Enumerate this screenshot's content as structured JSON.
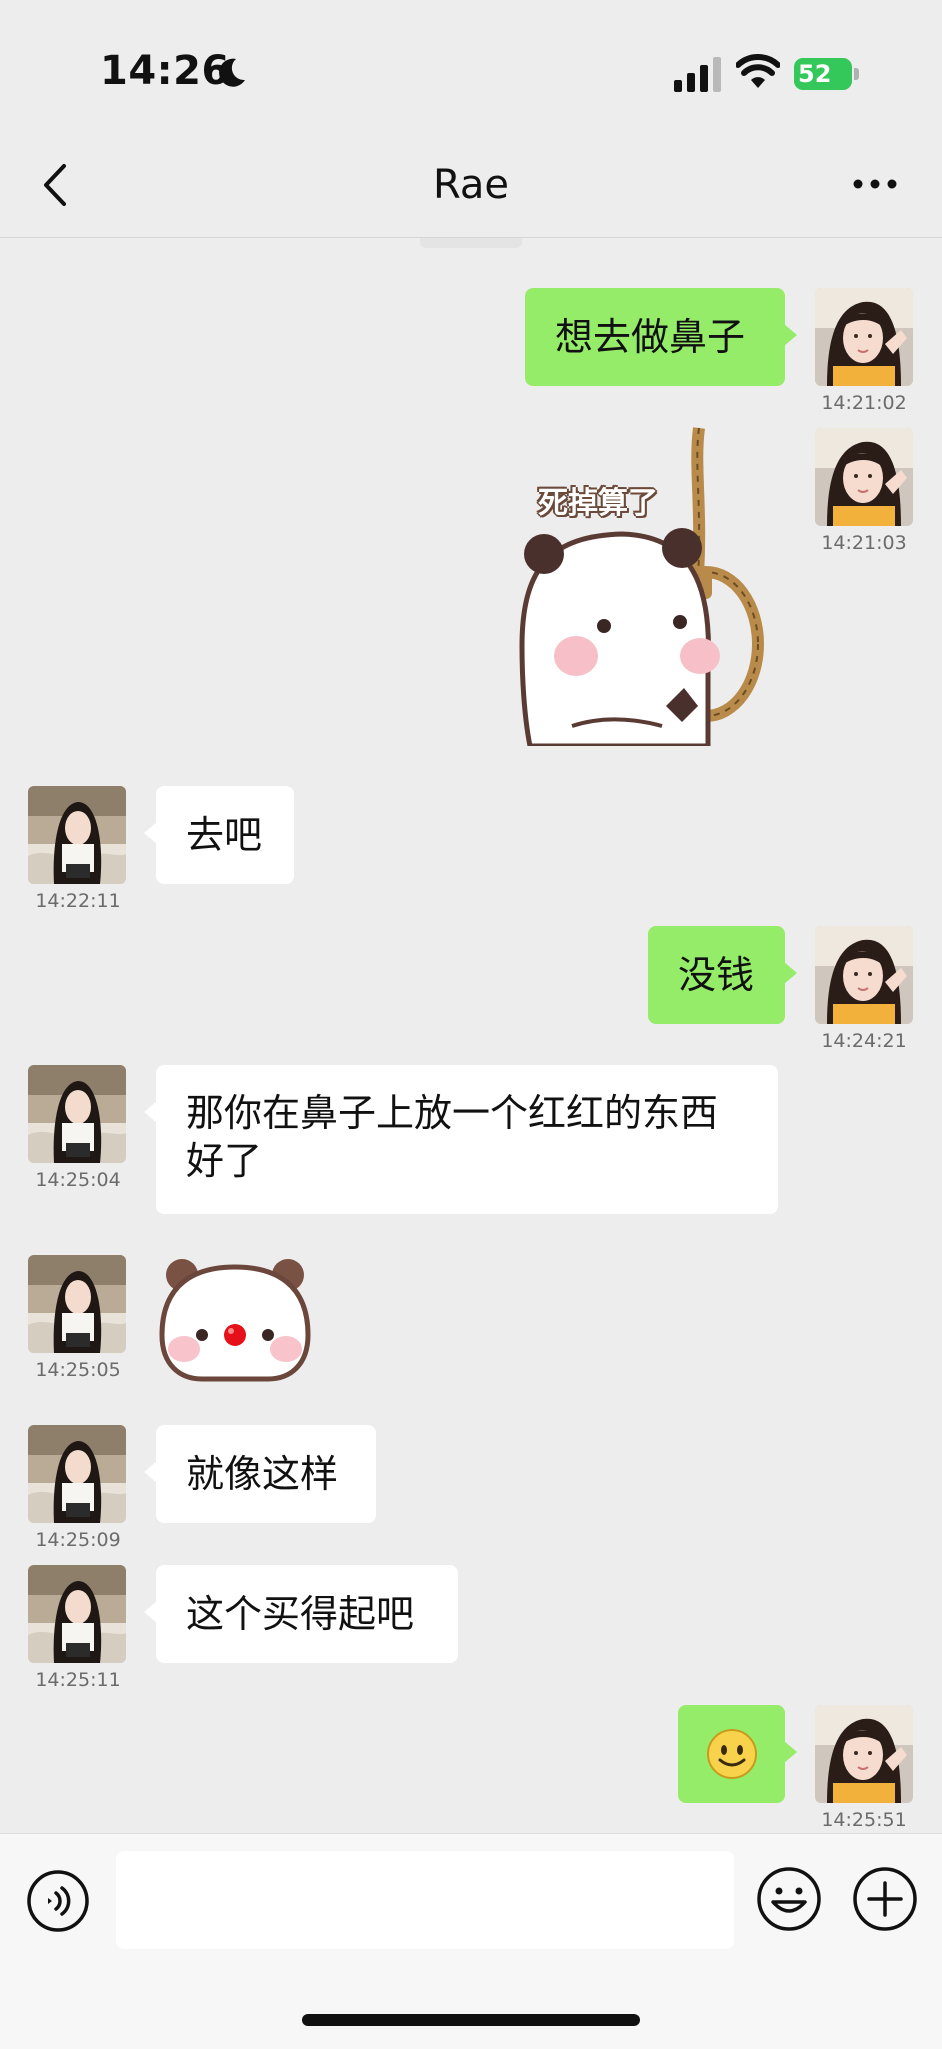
{
  "status_bar": {
    "time": "14:26",
    "battery": "52"
  },
  "header": {
    "title": "Rae"
  },
  "messages": [
    {
      "from": "me",
      "type": "text",
      "text": "想去做鼻子",
      "time": "14:21:02"
    },
    {
      "from": "me",
      "type": "sticker",
      "sticker_text": "死掉算了",
      "time": "14:21:03"
    },
    {
      "from": "them",
      "type": "text",
      "text": "去吧",
      "time": "14:22:11"
    },
    {
      "from": "me",
      "type": "text",
      "text": "没钱",
      "time": "14:24:21"
    },
    {
      "from": "them",
      "type": "text",
      "text": "那你在鼻子上放一个红红的东西",
      "text2": "好了",
      "time": "14:25:04"
    },
    {
      "from": "them",
      "type": "sticker",
      "time": "14:25:05"
    },
    {
      "from": "them",
      "type": "text",
      "text": "就像这样",
      "time": "14:25:09"
    },
    {
      "from": "them",
      "type": "text",
      "text": "这个买得起吧",
      "time": "14:25:11"
    },
    {
      "from": "me",
      "type": "emoji",
      "icon": "smile-emoji",
      "time": "14:25:51"
    }
  ],
  "colors": {
    "my_bubble": "#95ec69",
    "their_bubble": "#ffffff",
    "background": "#ededed"
  },
  "icons": {
    "back": "chevron-left-icon",
    "more": "more-dots-icon",
    "voice": "voice-icon",
    "emoji": "emoji-icon",
    "plus": "plus-icon"
  }
}
